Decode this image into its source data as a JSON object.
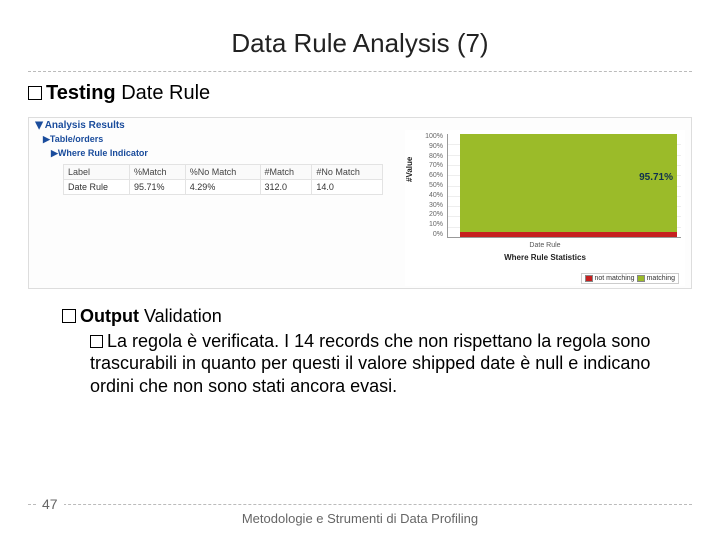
{
  "title": "Data Rule Analysis (7)",
  "testing_label": "Testing",
  "testing_rule": "Date Rule",
  "screenshot": {
    "analysis_results": "Analysis Results",
    "tablelorders": "Table/orders",
    "where_rule_indicator": "Where Rule Indicator",
    "table": {
      "headers": {
        "label": "Label",
        "pmatch": "%Match",
        "pnomatch": "%No Match",
        "nmatch": "#Match",
        "nnomatch": "#No Match"
      },
      "row": {
        "label": "Date Rule",
        "pmatch": "95.71%",
        "pnomatch": "4.29%",
        "nmatch": "312.0",
        "nnomatch": "14.0"
      }
    }
  },
  "chart_data": {
    "type": "bar",
    "categories": [
      "Date Rule"
    ],
    "series": [
      {
        "name": "not matching",
        "values": [
          4.29
        ]
      },
      {
        "name": "matching",
        "values": [
          95.71
        ]
      }
    ],
    "yticks": [
      "100%",
      "90%",
      "80%",
      "70%",
      "60%",
      "50%",
      "40%",
      "30%",
      "20%",
      "10%",
      "0%"
    ],
    "ylabel": "#Value",
    "chart_title": "Where Rule Statistics",
    "annotation": "95.71%",
    "legend": {
      "not_matching": "not matching",
      "matching": "matching"
    },
    "ylim": [
      0,
      100
    ]
  },
  "output": {
    "head_prefix": "Output",
    "head_suffix": "Validation",
    "body_prefix": "La",
    "body_text": "regola è verificata. I 14 records che non rispettano la regola sono trascurabili in quanto per questi il valore shipped date è null e indicano ordini che non sono stati ancora evasi."
  },
  "page_number": "47",
  "footer_text": "Metodologie e Strumenti di Data Profiling"
}
